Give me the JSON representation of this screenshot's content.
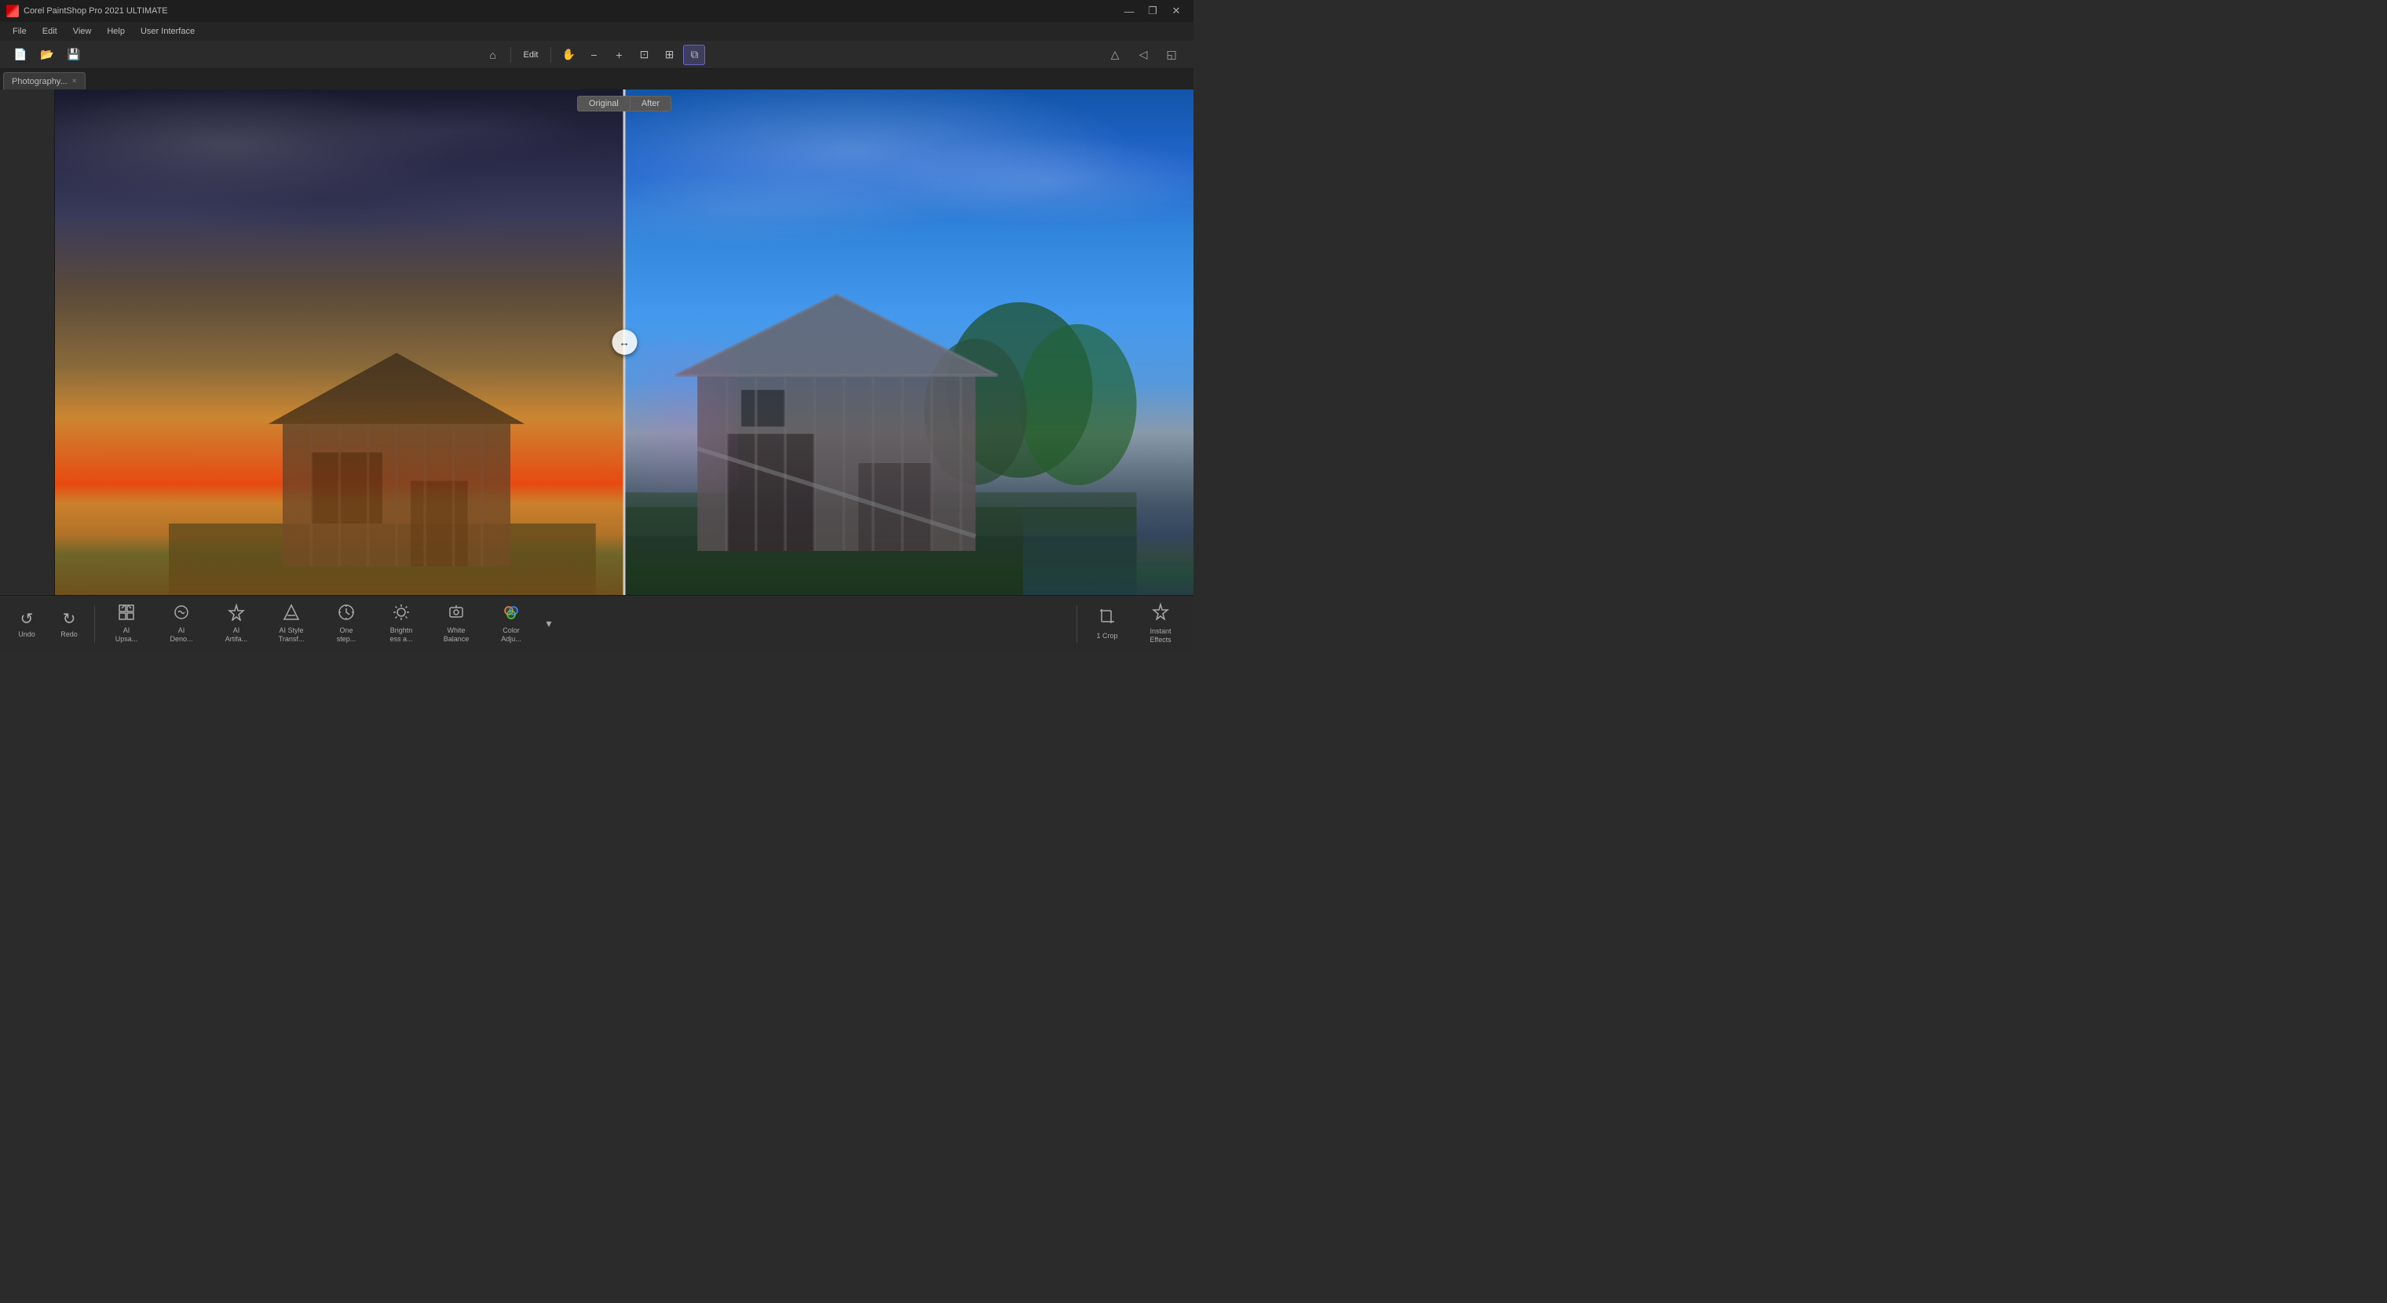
{
  "app": {
    "title": "Corel PaintShop Pro 2021 ULTIMATE",
    "logo_color": "#cc2222"
  },
  "titlebar": {
    "minimize_label": "—",
    "restore_label": "❐",
    "close_label": "✕"
  },
  "menubar": {
    "items": [
      {
        "id": "file",
        "label": "File"
      },
      {
        "id": "edit",
        "label": "Edit"
      },
      {
        "id": "view",
        "label": "View"
      },
      {
        "id": "help",
        "label": "Help"
      },
      {
        "id": "ui",
        "label": "User Interface"
      }
    ]
  },
  "topbar": {
    "edit_label": "Edit",
    "home_icon": "⌂",
    "pipe": "|"
  },
  "toolbar_center": {
    "hand_icon": "✋",
    "zoom_out_icon": "−",
    "zoom_in_icon": "+",
    "fit_icon": "⊡",
    "crop_view_icon": "⊞",
    "split_icon": "⧉"
  },
  "toolbar_right": {
    "btn1_icon": "△",
    "btn2_icon": "◁",
    "btn3_icon": "◱"
  },
  "tab": {
    "label": "Photography...",
    "close_icon": "×"
  },
  "canvas": {
    "original_label": "Original",
    "after_label": "After",
    "split_handle": "↔"
  },
  "bottom_undo": {
    "undo_icon": "↺",
    "undo_label": "Undo",
    "redo_icon": "↻",
    "redo_label": "Redo"
  },
  "bottom_tools": [
    {
      "id": "ai-upscale",
      "icon": "⊞",
      "label": "AI\nUpsa..."
    },
    {
      "id": "ai-denoise",
      "icon": "✦",
      "label": "AI\nDeno..."
    },
    {
      "id": "ai-artifact",
      "icon": "✧",
      "label": "AI\nArtifa..."
    },
    {
      "id": "ai-style",
      "icon": "△",
      "label": "AI Style\nTransf..."
    },
    {
      "id": "one-step",
      "icon": "✱",
      "label": "One\nstep..."
    },
    {
      "id": "brightness",
      "icon": "❊",
      "label": "Brightn\ness a..."
    },
    {
      "id": "white-balance",
      "icon": "◈",
      "label": "White\nBalance"
    },
    {
      "id": "color-adj",
      "icon": "◉",
      "label": "Color\nAdju..."
    }
  ],
  "bottom_expand": {
    "icon": "▾"
  },
  "right_tools": [
    {
      "id": "crop",
      "icon": "⊡",
      "label": "1 Crop"
    },
    {
      "id": "instant-effects",
      "icon": "✦",
      "label": "Instant\nEffects"
    }
  ]
}
